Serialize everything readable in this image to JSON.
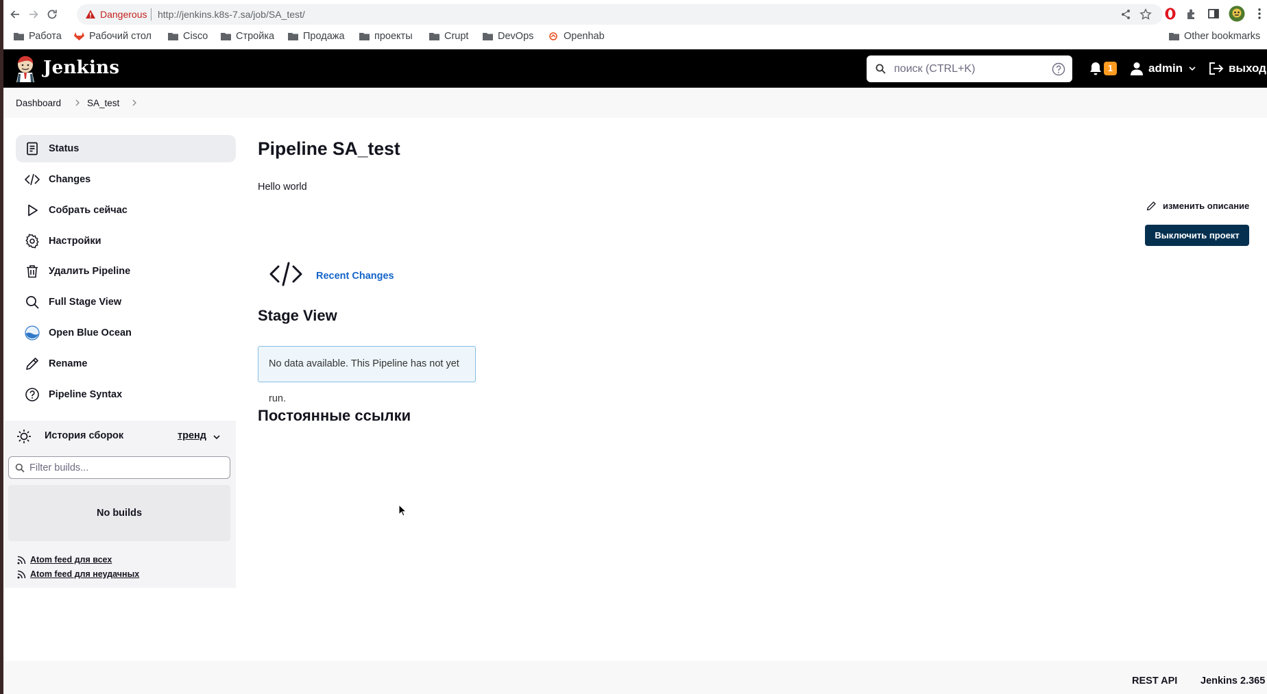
{
  "browser": {
    "security_label": "Dangerous",
    "url": "http://jenkins.k8s-7.sa/job/SA_test/",
    "bookmarks": [
      {
        "label": "Работа",
        "icon": "folder-icon"
      },
      {
        "label": "Рабочий стол",
        "icon": "gitlab-fox-icon"
      },
      {
        "label": "Cisco",
        "icon": "folder-icon"
      },
      {
        "label": "Стройка",
        "icon": "folder-icon"
      },
      {
        "label": "Продажа",
        "icon": "folder-icon"
      },
      {
        "label": "проекты",
        "icon": "folder-icon"
      },
      {
        "label": "Crupt",
        "icon": "folder-icon"
      },
      {
        "label": "DevOps",
        "icon": "folder-icon"
      },
      {
        "label": "Openhab",
        "icon": "openhab-icon"
      }
    ],
    "other_bookmarks": "Other bookmarks"
  },
  "header": {
    "logo_text": "Jenkins",
    "search_placeholder": "поиск (CTRL+K)",
    "notification_count": "1",
    "user": "admin",
    "logout": "выход"
  },
  "breadcrumb": [
    "Dashboard",
    "SA_test"
  ],
  "sidebar": {
    "items": [
      {
        "label": "Status",
        "icon": "clipboard-icon"
      },
      {
        "label": "Changes",
        "icon": "code-icon"
      },
      {
        "label": "Собрать сейчас",
        "icon": "play-icon"
      },
      {
        "label": "Настройки",
        "icon": "gear-icon"
      },
      {
        "label": "Удалить Pipeline",
        "icon": "trash-icon"
      },
      {
        "label": "Full Stage View",
        "icon": "search-icon"
      },
      {
        "label": "Open Blue Ocean",
        "icon": "blue-ocean-icon"
      },
      {
        "label": "Rename",
        "icon": "pencil-icon"
      },
      {
        "label": "Pipeline Syntax",
        "icon": "help-circle-icon"
      }
    ],
    "build_history": {
      "title": "История сборок",
      "trend": "тренд",
      "filter_placeholder": "Filter builds...",
      "empty": "No builds",
      "atom_all": "Atom feed для всех",
      "atom_failed": "Atom feed для неудачных"
    }
  },
  "main": {
    "title": "Pipeline SA_test",
    "description": "Hello world",
    "edit_description": "изменить описание",
    "disable_button": "Выключить проект",
    "recent_changes": "Recent Changes",
    "stage_view_title": "Stage View",
    "stage_view_empty": "No data available. This Pipeline has not yet run.",
    "permalinks_title": "Постоянные ссылки"
  },
  "footer": {
    "rest_api": "REST API",
    "version": "Jenkins 2.365"
  },
  "colors": {
    "header_bg": "#000000",
    "primary_button": "#063050",
    "link": "#1464c8",
    "badge": "#fe9b20",
    "danger": "#c5221f"
  }
}
